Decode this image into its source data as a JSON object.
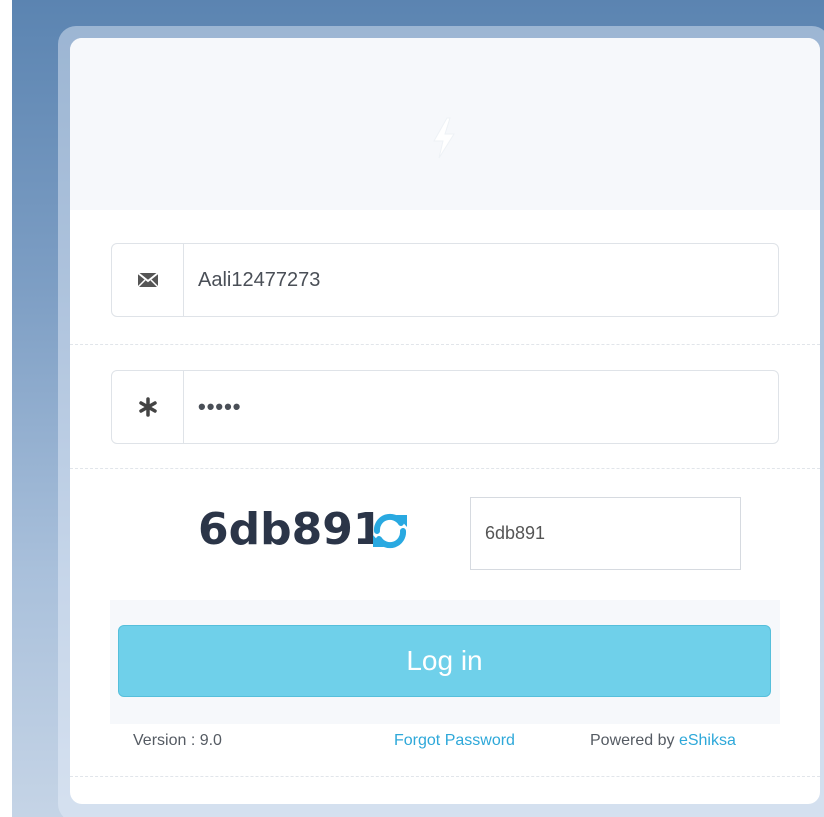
{
  "header": {
    "logo_icon": "bolt-icon"
  },
  "login_form": {
    "username": {
      "icon": "envelope-icon",
      "value": "Aali12477273"
    },
    "password": {
      "icon": "asterisk-icon",
      "value": "•••••"
    },
    "captcha": {
      "code": "6db891",
      "refresh_icon": "refresh-icon",
      "input_value": "6db891"
    },
    "login_label": "Log in"
  },
  "footer": {
    "version": "Version : 9.0",
    "forgot_password": "Forgot Password",
    "powered_by_prefix": "Powered by",
    "powered_by_brand": "eShiksa"
  },
  "colors": {
    "accent": "#6fd0ea",
    "link": "#2ea8d9",
    "captcha_text": "#2b3548"
  }
}
